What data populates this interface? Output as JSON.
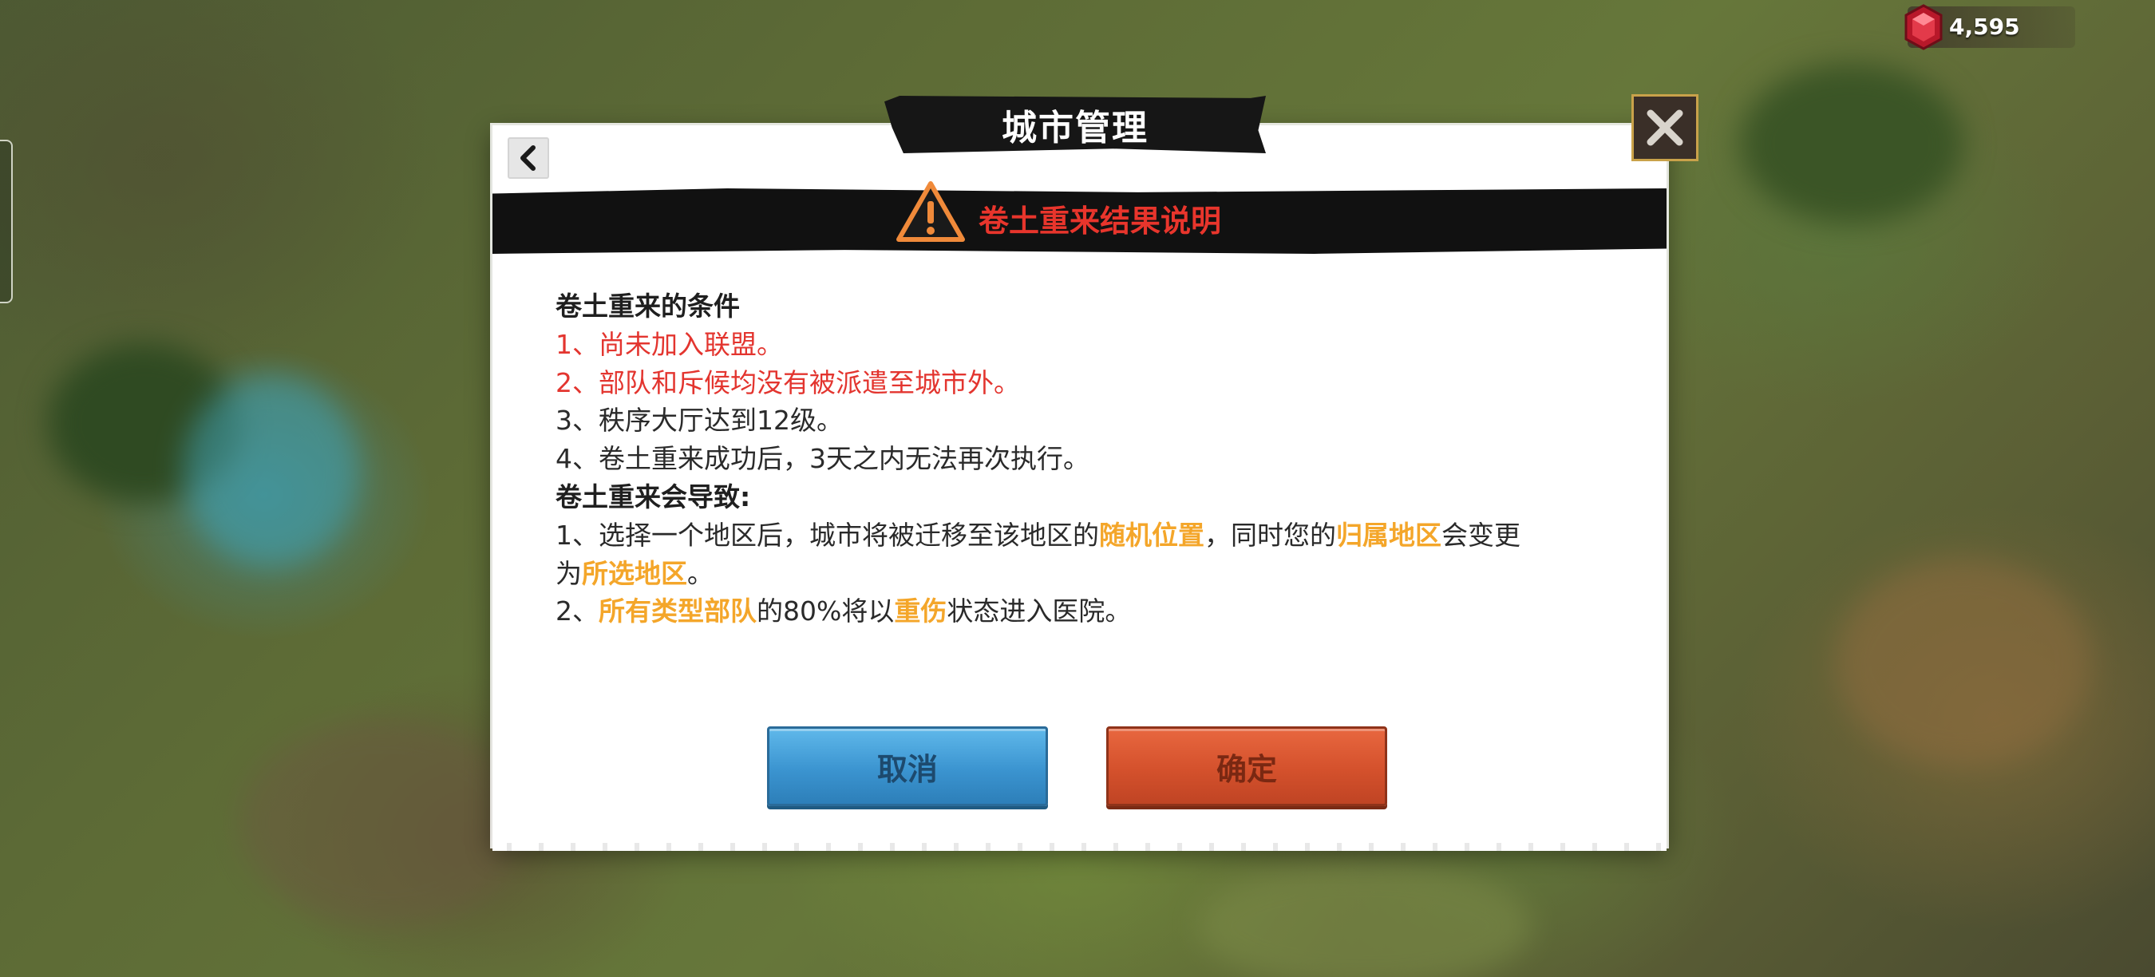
{
  "header": {
    "gem_icon": "red-gem-icon",
    "gem_count": "4,595"
  },
  "dialog": {
    "title": "城市管理",
    "back_icon": "chevron-left-icon",
    "close_icon": "close-x-icon",
    "warning_icon": "warning-triangle-icon",
    "subtitle": "卷土重来结果说明",
    "conditions_heading": "卷土重来的条件",
    "conditions": [
      "1、尚未加入联盟。",
      "2、部队和斥候均没有被派遣至城市外。",
      "3、秩序大厅达到12级。",
      "4、卷土重来成功后，3天之内无法再次执行。"
    ],
    "effects_heading": "卷土重来会导致:",
    "effect1": {
      "part1": "1、选择一个地区后，城市将被迁移至该地区的",
      "hl1": "随机位置",
      "part2": "，同时您的",
      "hl2": "归属地区",
      "part3": "会变更",
      "part4": "为",
      "hl3": "所选地区",
      "part5": "。"
    },
    "effect2": {
      "part1": "2、",
      "hl1": "所有类型部队",
      "part2": "的80%将以",
      "hl2": "重伤",
      "part3": "状态进入医院。"
    },
    "cancel_label": "取消",
    "confirm_label": "确定"
  },
  "colors": {
    "warning_red": "#e3352f",
    "highlight_orange": "#f4a62a",
    "cancel_blue": "#3b94d0",
    "confirm_orange": "#d4512c"
  }
}
